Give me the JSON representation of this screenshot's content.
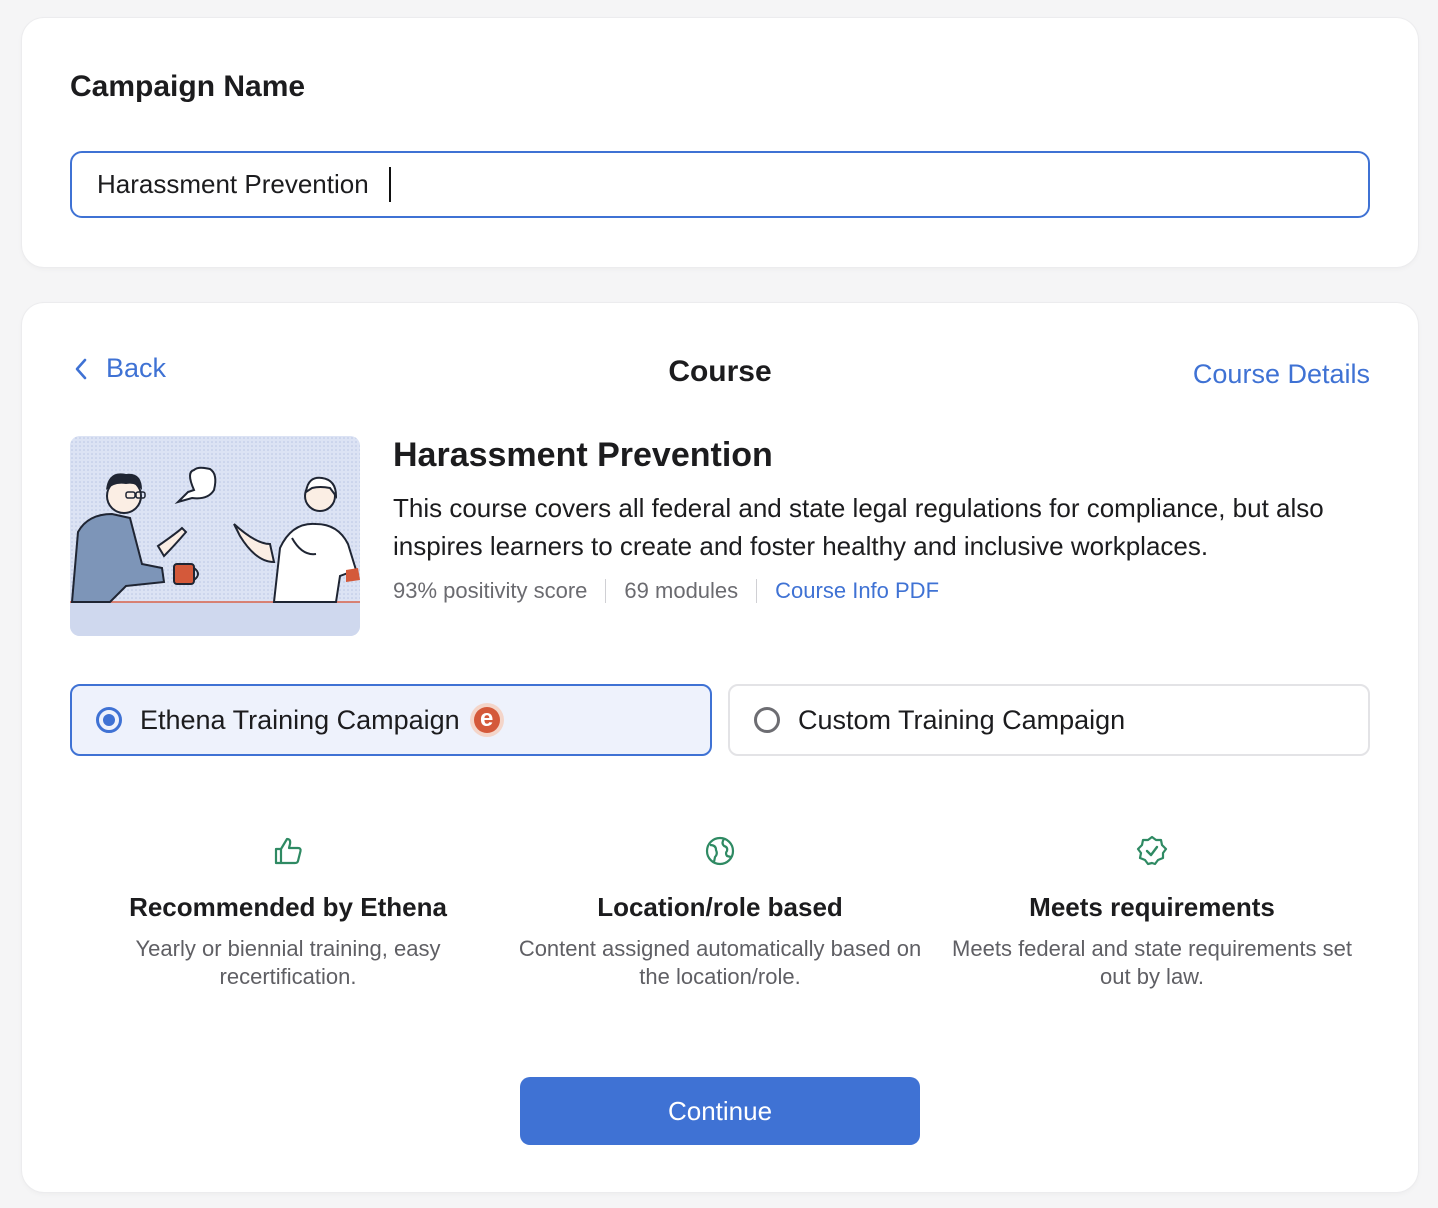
{
  "campaign": {
    "label": "Campaign Name",
    "value": "Harassment Prevention"
  },
  "header": {
    "back_label": "Back",
    "title": "Course",
    "details_link": "Course Details"
  },
  "course": {
    "title": "Harassment Prevention",
    "description": "This course covers all federal and state legal regulations for compliance, but also inspires learners to create and foster healthy and inclusive workplaces.",
    "positivity": "93% positivity score",
    "modules": "69 modules",
    "pdf_link": "Course Info PDF"
  },
  "options": [
    {
      "label": "Ethena Training Campaign",
      "selected": true,
      "logo_letter": "e"
    },
    {
      "label": "Custom Training Campaign",
      "selected": false
    }
  ],
  "features": [
    {
      "icon": "thumbs-up-icon",
      "title": "Recommended by Ethena",
      "description": "Yearly or biennial training, easy recertification."
    },
    {
      "icon": "globe-icon",
      "title": "Location/role based",
      "description": "Content assigned automatically based on the location/role."
    },
    {
      "icon": "verified-badge-icon",
      "title": "Meets requirements",
      "description": "Meets federal and state requirements set out by law."
    }
  ],
  "continue_label": "Continue",
  "colors": {
    "accent": "#3f72d4",
    "feature_icon": "#2f8a63",
    "brand_logo": "#d4593a"
  }
}
